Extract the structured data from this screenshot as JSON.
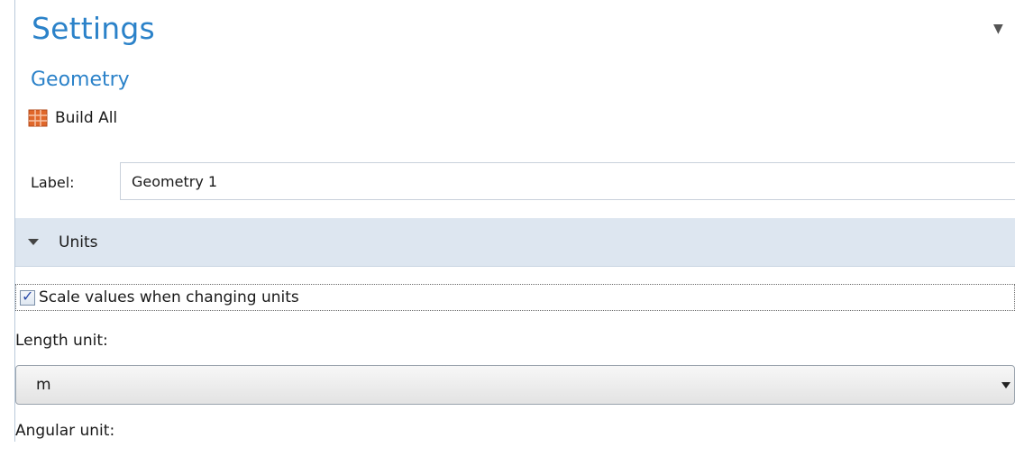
{
  "panel": {
    "title": "Settings",
    "subtitle": "Geometry"
  },
  "toolbar": {
    "build_all_label": "Build All",
    "build_icon": "geometry-build-icon"
  },
  "label_field": {
    "caption": "Label:",
    "value": "Geometry 1"
  },
  "units_section": {
    "header": "Units",
    "scale_checkbox": {
      "label": "Scale values when changing units",
      "checked": true
    },
    "length_unit": {
      "caption": "Length unit:",
      "selected": "m"
    },
    "angular_unit": {
      "caption": "Angular unit:"
    }
  },
  "colors": {
    "accent": "#2b82c9",
    "section_bg": "#dde6f0",
    "build_icon": "#e0672a"
  }
}
